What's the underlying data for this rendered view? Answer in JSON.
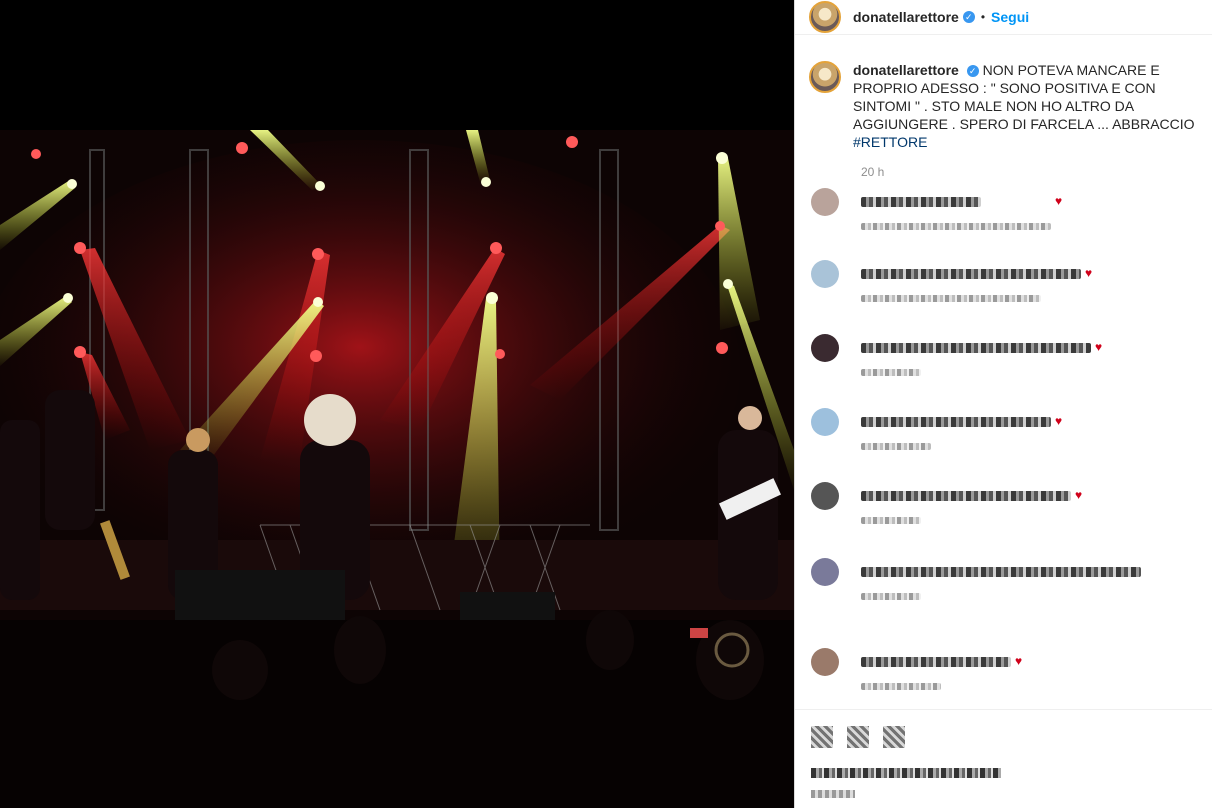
{
  "post": {
    "username": "donatellarettore",
    "verified_mark": "✓",
    "separator": "•",
    "follow_label": "Segui",
    "caption_text": "NON POTEVA MANCARE E PROPRIO ADESSO : \" SONO POSITIVA E CON SINTOMI \" . STO MALE NON HO ALTRO DA AGGIUNGERE . SPERO DI FARCELA ... ABBRACCIO",
    "hashtag": "#RETTORE",
    "time_ago": "20 h"
  },
  "comments_icons": {
    "heart": "♥"
  },
  "colors": {
    "follow_blue": "#0095f6",
    "verified_blue": "#3897f0",
    "story_ring": "#e4a33a",
    "heart_red": "#d0021b"
  },
  "icons": [
    "heart-icon",
    "comment-icon",
    "share-icon",
    "save-icon",
    "verified-icon"
  ]
}
